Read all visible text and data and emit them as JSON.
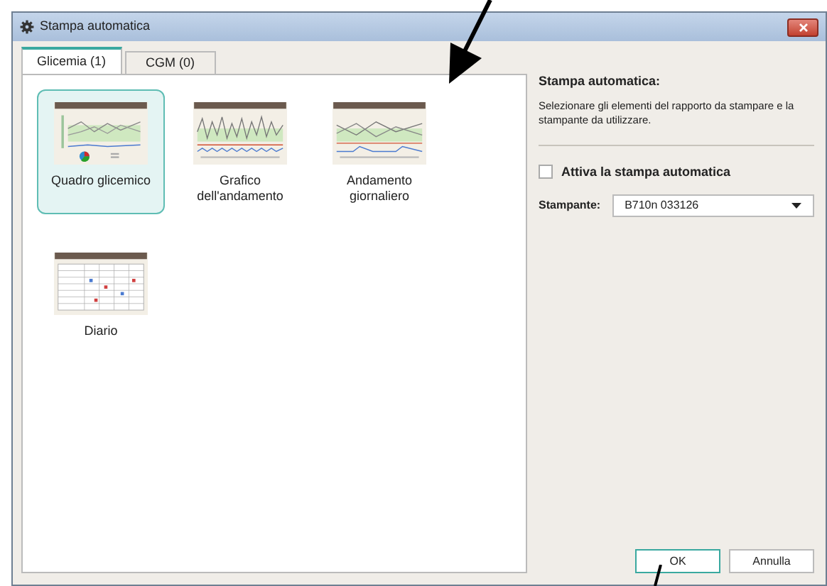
{
  "window": {
    "title": "Stampa automatica"
  },
  "tabs": [
    {
      "label": "Glicemia (1)",
      "selected": true
    },
    {
      "label": "CGM (0)",
      "selected": false
    }
  ],
  "reports": [
    {
      "label": "Quadro glicemico",
      "kind": "summary",
      "selected": true
    },
    {
      "label": "Grafico dell'andamento",
      "kind": "trend",
      "selected": false
    },
    {
      "label": "Andamento giornaliero",
      "kind": "daily",
      "selected": false
    },
    {
      "label": "Diario",
      "kind": "diary",
      "selected": false
    }
  ],
  "side_panel": {
    "heading": "Stampa automatica:",
    "description": "Selezionare gli elementi del rapporto da stampare e la stampante da utilizzare.",
    "auto_print": {
      "label": "Attiva la stampa automatica",
      "checked": false
    },
    "printer": {
      "label": "Stampante:",
      "value": "B710n 033126"
    }
  },
  "buttons": [
    {
      "label": "OK",
      "selected": true
    },
    {
      "label": "Annulla",
      "selected": false
    }
  ]
}
